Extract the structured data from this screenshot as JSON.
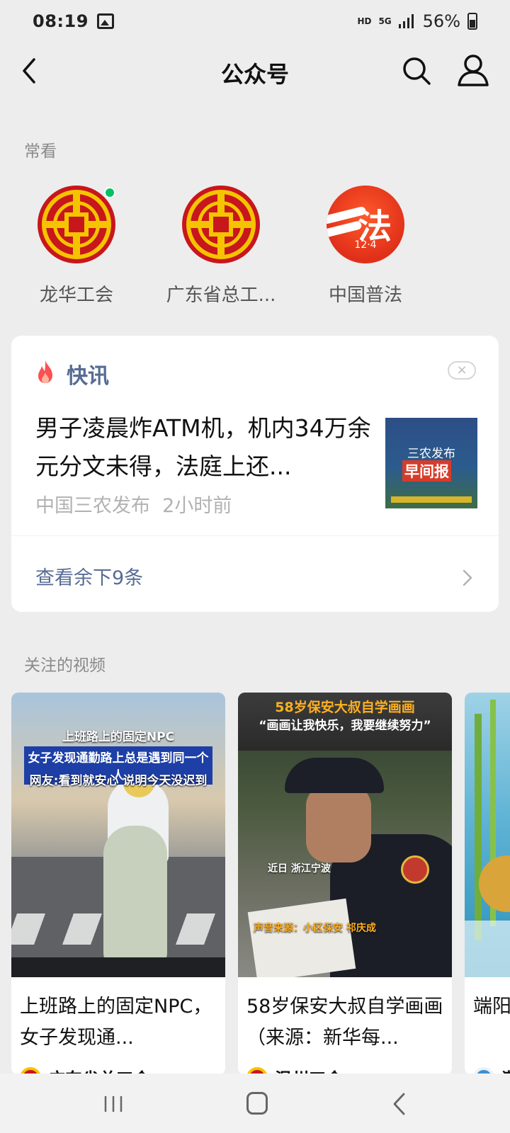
{
  "status_bar": {
    "time": "08:19",
    "hd": "HD",
    "network": "5G",
    "battery": "56%"
  },
  "nav": {
    "title": "公众号"
  },
  "frequent": {
    "label": "常看",
    "items": [
      {
        "name": "龙华工会",
        "icon": "union-logo-icon",
        "unread": true
      },
      {
        "name": "广东省总工...",
        "icon": "union-logo-icon",
        "unread": false
      },
      {
        "name": "中国普法",
        "icon": "law-logo-icon",
        "logo_glyph": "法",
        "logo_date": "12·4",
        "unread": false
      }
    ]
  },
  "news": {
    "heading": "快讯",
    "close": "×",
    "headline": "男子凌晨炸ATM机，机内34万余元分文未得，法庭上还...",
    "source": "中国三农发布",
    "time": "2小时前",
    "thumb_line1": "三农发布",
    "thumb_line2": "早间报",
    "more": "查看余下9条"
  },
  "videos": {
    "label": "关注的视频",
    "items": [
      {
        "title": "上班路上的固定NPC，女子发现通...",
        "source": "广东省总工会",
        "cover_caption_1": "上班路上的固定NPC",
        "cover_caption_2": "女子发现通勤路上总是遇到同一个人",
        "cover_caption_3": "网友:看到就安心 说明今天没迟到"
      },
      {
        "title": "58岁保安大叔自学画画（来源：新华每...",
        "source": "温州工会",
        "cover_caption_1": "58岁保安大叔自学画画",
        "cover_caption_2": "“画画让我快乐，我要继续努力”",
        "cover_caption_3": "近日 浙江宁波",
        "cover_caption_4": "声音来源：小区保安 祁庆成"
      },
      {
        "title": "端阳 | 渤",
        "source": "渤"
      }
    ]
  },
  "colors": {
    "background": "#ededed",
    "link": "#576b95",
    "unread_dot": "#07c160",
    "flame": "#fa5151"
  }
}
